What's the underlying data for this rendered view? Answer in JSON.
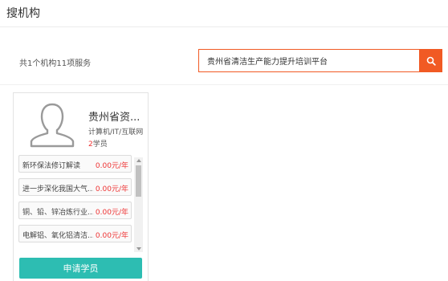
{
  "page": {
    "title": "搜机构"
  },
  "results": {
    "summary": "共1个机构11项服务"
  },
  "search": {
    "value": "贵州省清洁生产能力提升培训平台",
    "button_icon": "search-icon",
    "accent_color": "#f15a24"
  },
  "org_card": {
    "name": "贵州省资...",
    "category": "计算机/IT/互联网",
    "members_count": "2",
    "members_label": "学员",
    "services": [
      {
        "name": "新环保法修订解读",
        "price": "0.00元/年"
      },
      {
        "name": "进一步深化我国大气...",
        "price": "0.00元/年"
      },
      {
        "name": "铜、铅、锌冶炼行业...",
        "price": "0.00元/年"
      },
      {
        "name": "电解铝、氧化铝清洁...",
        "price": "0.00元/年"
      }
    ],
    "apply_label": "申请学员",
    "apply_color": "#2dbdb2",
    "price_color": "#ee3333"
  }
}
